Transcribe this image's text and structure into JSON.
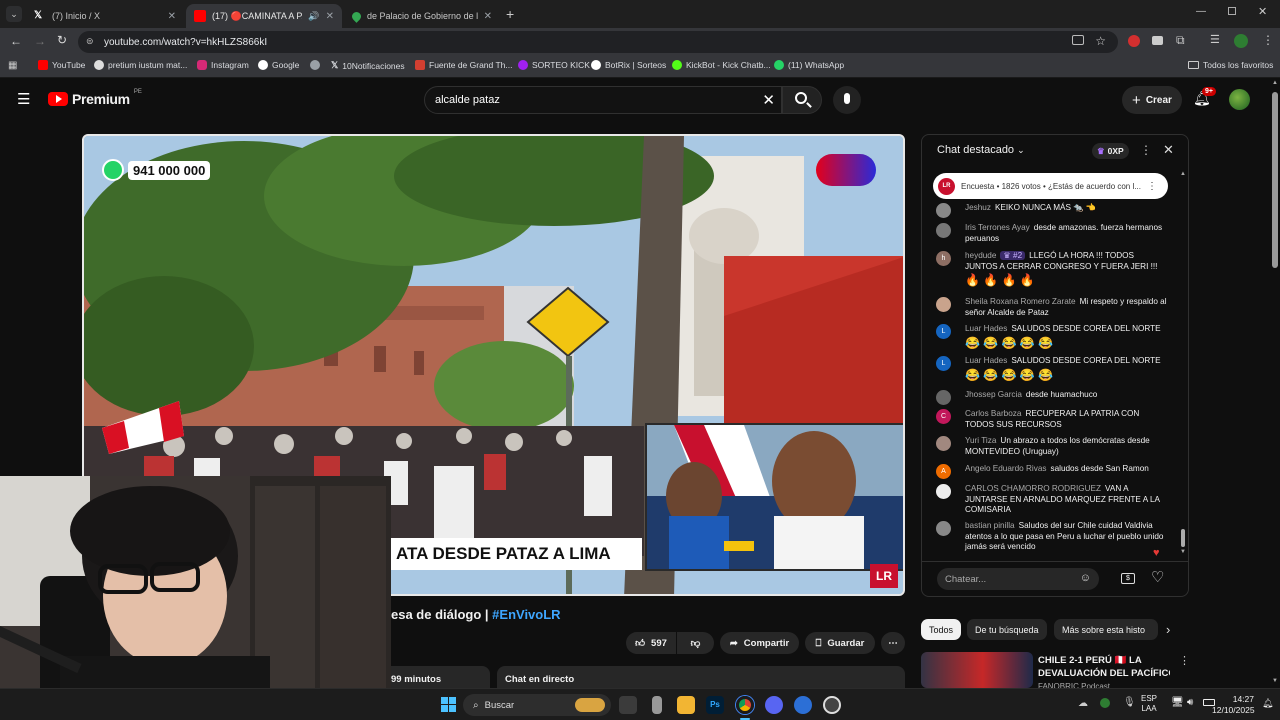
{
  "tabs": [
    {
      "title": "(7) Inicio / X",
      "color": "#ffffff"
    },
    {
      "title": "(17) 🔴CAMINATA A PALAC",
      "color": "#ff0000"
    },
    {
      "title": "de Palacio de Gobierno de la R",
      "color": "#34a853"
    }
  ],
  "browser": {
    "url": "youtube.com/watch?v=hkHLZS866kI"
  },
  "bookmarks": [
    {
      "label": "YouTube",
      "color": "#ff0000"
    },
    {
      "label": "pretium iustum mat...",
      "color": "#ffffff"
    },
    {
      "label": "Instagram",
      "color": "#d62976"
    },
    {
      "label": "Google",
      "color": "#ffffff"
    },
    {
      "label": "",
      "color": "#9aa0a6"
    },
    {
      "label": "10Notificaciones",
      "color": "#ffffff"
    },
    {
      "label": "Fuente de Grand Th...",
      "color": "#d23f31"
    },
    {
      "label": "SORTEO KICK",
      "color": "#a020f0"
    },
    {
      "label": "BotRix | Sorteos",
      "color": "#ffffff"
    },
    {
      "label": "KickBot - Kick Chatb...",
      "color": "#53fc18"
    },
    {
      "label": "(11) WhatsApp",
      "color": "#25d366"
    }
  ],
  "bookmarks_all": "Todos los favoritos",
  "youtube": {
    "logo": "Premium",
    "logo_badge": "PE",
    "search_value": "alcalde pataz",
    "create_label": "Crear",
    "notif_count": "9+"
  },
  "video": {
    "phone": "941 000 000",
    "lower_third": "ATA DESDE PATAZ A LIMA",
    "channel_mark": "LR"
  },
  "below_video": {
    "title_part": "esa de diálogo | ",
    "title_hashtag": "#EnVivoLR",
    "likes": "597",
    "share_label": "Compartir",
    "save_label": "Guardar",
    "minutes_label": "99 minutos",
    "live_chat_label": "Chat en directo"
  },
  "chat": {
    "header": "Chat destacado",
    "xp": "0XP",
    "poll_text": "Encuesta • 1826 votos • ¿Estás de acuerdo con l...",
    "input_placeholder": "Chatear...",
    "messages": [
      {
        "author": "Jeshuz",
        "text": "KEIKO NUNCA MÁS 🐀 👈",
        "color": "#888"
      },
      {
        "author": "Iris Terrones Ayay",
        "text": "desde amazonas. fuerza hermanos peruanos",
        "color": "#777"
      },
      {
        "author": "heydude",
        "badge": "#2",
        "text": "LLEGÓ LA HORA !!! TODOS JUNTOS A CERRAR CONGRESO Y FUERA JERI !!!",
        "emoji": "🔥 🔥 🔥 🔥",
        "color": "#8d6e63"
      },
      {
        "author": "Sheila Roxana Romero Zarate",
        "text": "Mi respeto y respaldo al señor Alcalde de Pataz",
        "color": "#c9a38c"
      },
      {
        "author": "Luar Hades",
        "text": "SALUDOS DESDE COREA DEL NORTE",
        "emoji": "😂 😂 😂 😂 😂",
        "color": "#1565c0"
      },
      {
        "author": "Luar Hades",
        "text": "SALUDOS DESDE COREA DEL NORTE",
        "emoji": "😂 😂 😂 😂 😂",
        "color": "#1565c0"
      },
      {
        "author": "Jhossep Garcia",
        "text": "desde huamachuco",
        "color": "#666"
      },
      {
        "author": "Carlos Barboza",
        "text": "RECUPERAR LA PATRIA CON TODOS SUS RECURSOS",
        "color": "#c2185b"
      },
      {
        "author": "Yuri Tiza",
        "text": "Un abrazo a todos los demócratas desde MONTEVIDEO (Uruguay)",
        "color": "#a1887f"
      },
      {
        "author": "Angelo Eduardo Rivas",
        "text": "saludos desde San Ramon",
        "color": "#ef6c00"
      },
      {
        "author": "CARLOS CHAMORRO RODRIGUEZ",
        "text": "VAN A JUNTARSE EN ARNALDO MARQUEZ FRENTE A LA COMISARIA",
        "color": "#eeeeee"
      },
      {
        "author": "bastian pinilla",
        "text": "Saludos del sur Chile cuidad Valdivia atentos a lo que pasa en Peru a luchar el pueblo unido jamás será vencido",
        "color": "#888"
      }
    ]
  },
  "chips": [
    "Todos",
    "De tu búsqueda",
    "Más sobre esta histo"
  ],
  "recommended": {
    "title_line1": "CHILE 2-1 PERÚ 🇵🇪 LA",
    "title_line2": "DEVALUACIÓN DEL PACÍFICO...",
    "channel": "FANOBRIC Podcast"
  },
  "taskbar": {
    "search": "Buscar",
    "lang_top": "ESP",
    "lang_bottom": "LAA",
    "time": "14:27",
    "date": "12/10/2025"
  }
}
